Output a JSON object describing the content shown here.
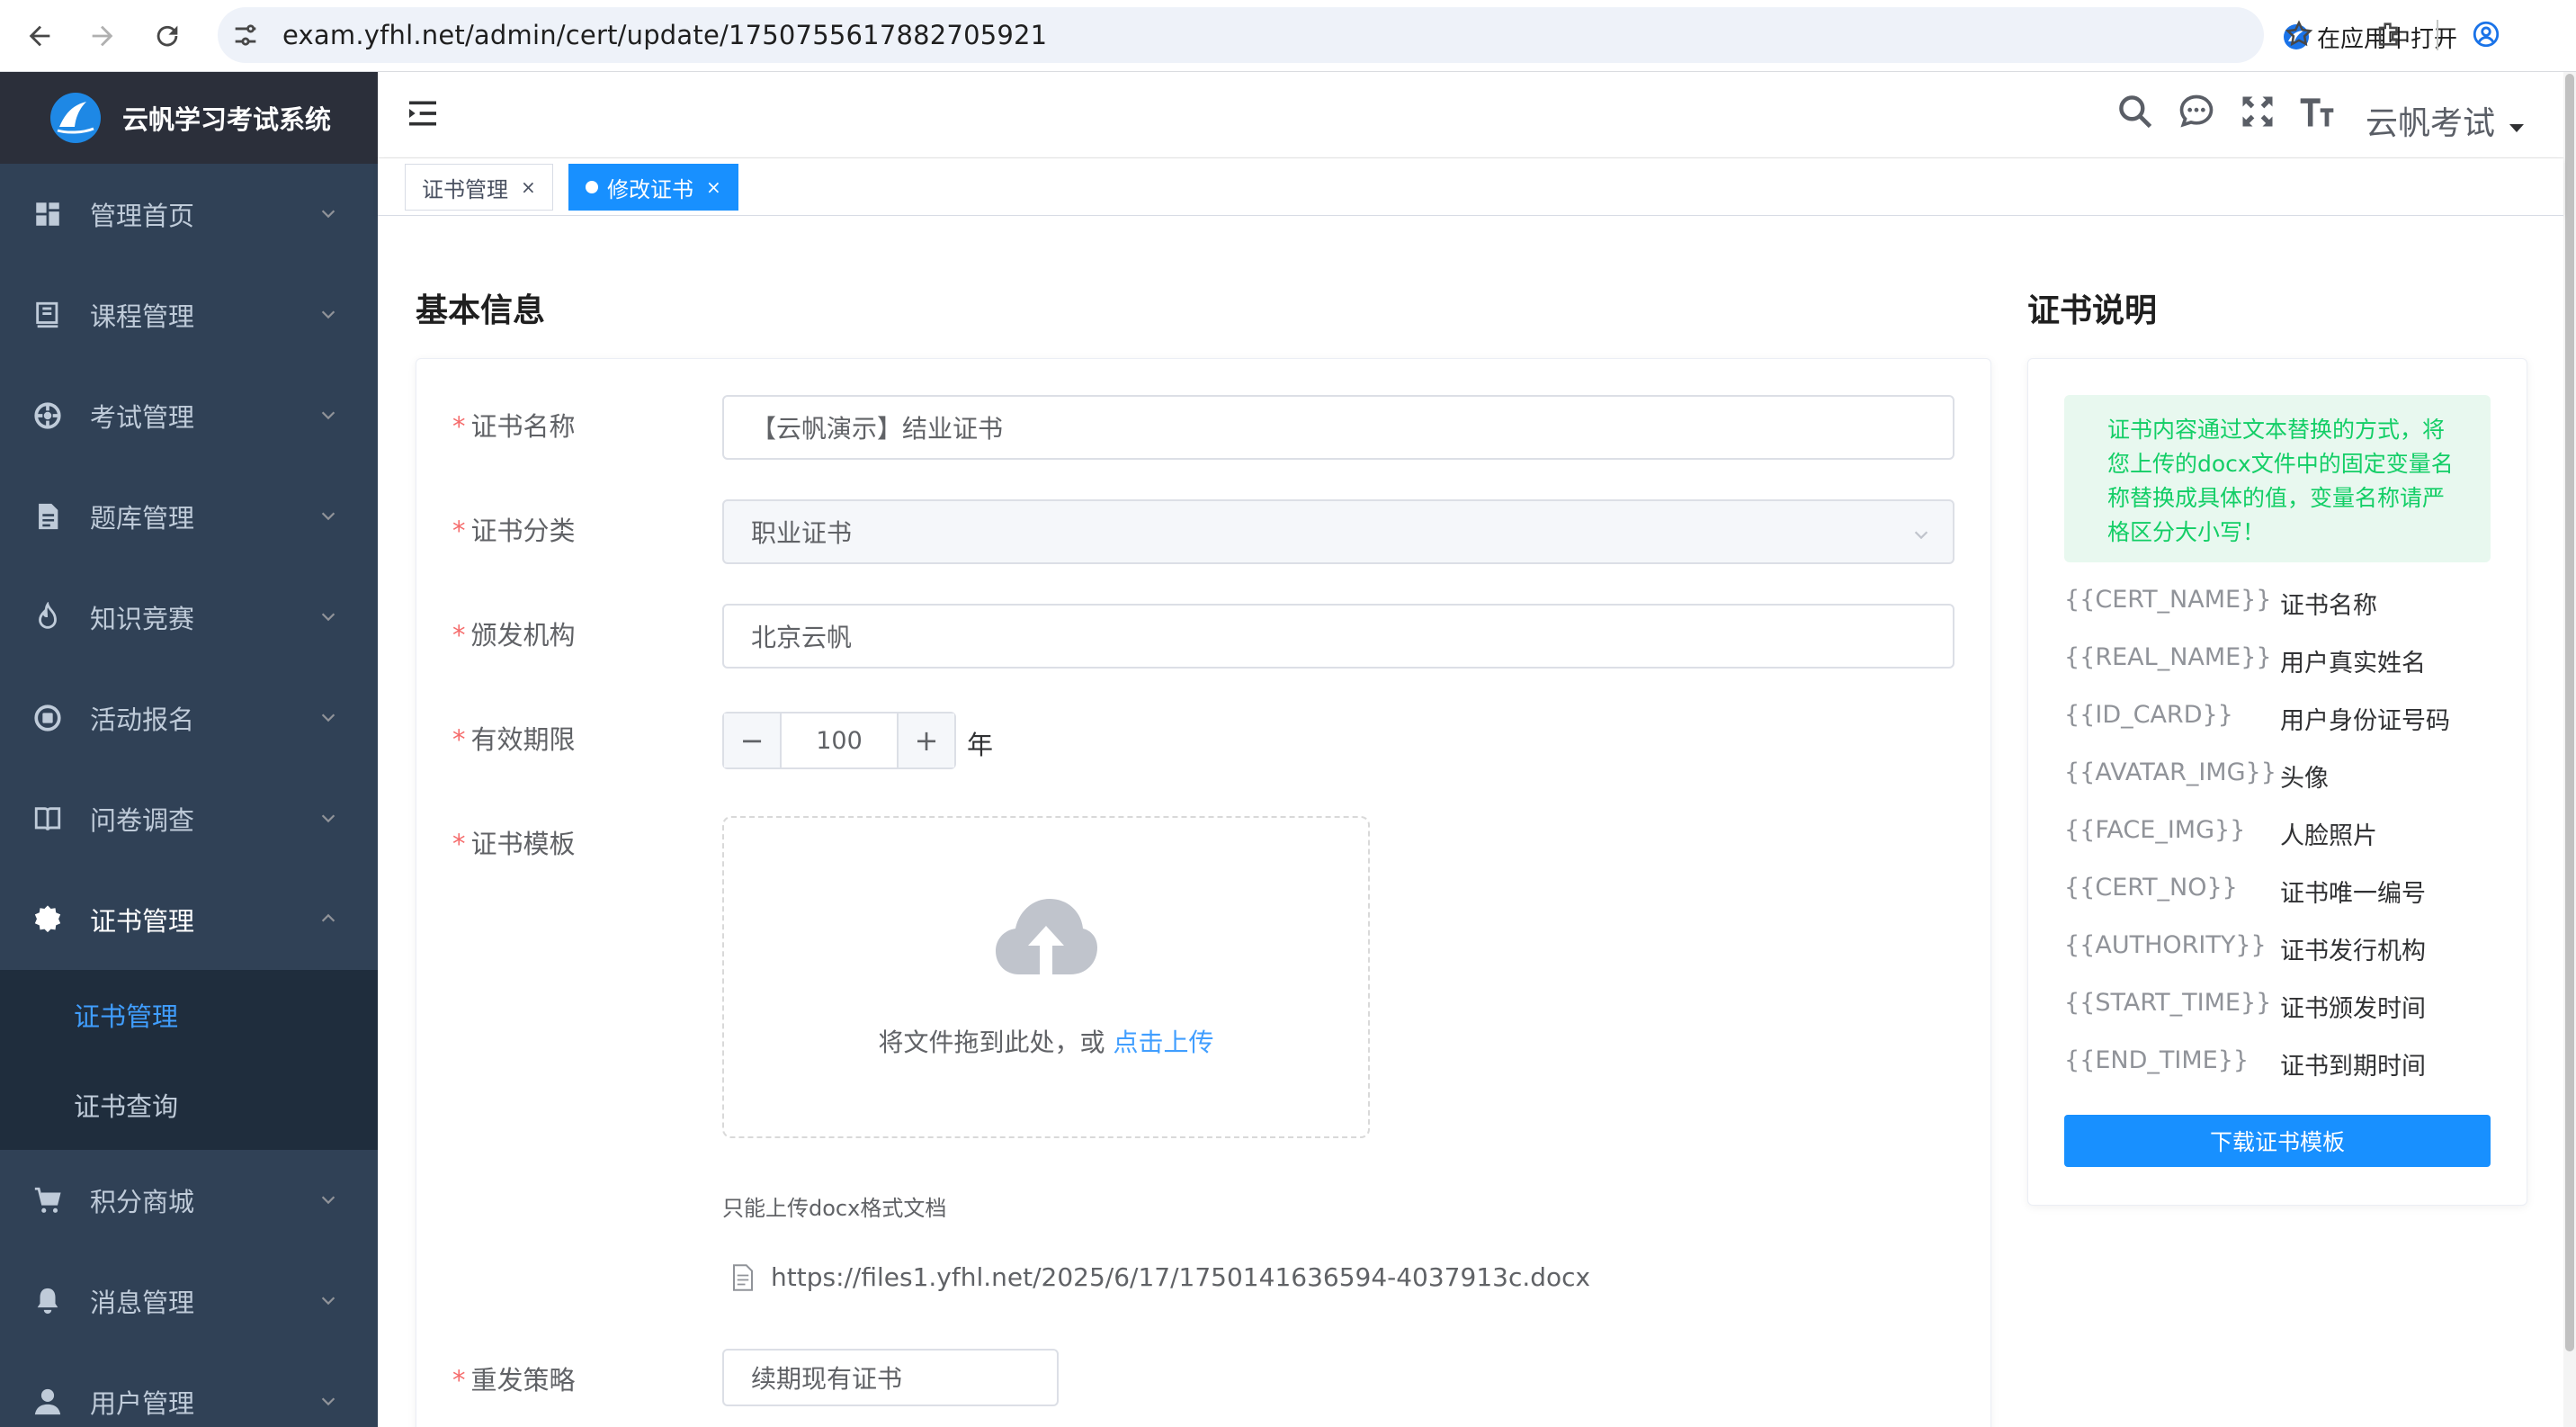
{
  "browser": {
    "url": "exam.yfhl.net/admin/cert/update/1750755617882705921",
    "open_in_app": "在应用中打开"
  },
  "app": {
    "brand_title": "云帆学习考试系统",
    "user_name": "云帆考试"
  },
  "sidebar": {
    "items": [
      {
        "label": "管理首页",
        "icon": "dashboard-icon"
      },
      {
        "label": "课程管理",
        "icon": "course-icon"
      },
      {
        "label": "考试管理",
        "icon": "exam-icon"
      },
      {
        "label": "题库管理",
        "icon": "question-bank-icon"
      },
      {
        "label": "知识竞赛",
        "icon": "fire-icon"
      },
      {
        "label": "活动报名",
        "icon": "activity-icon"
      },
      {
        "label": "问卷调查",
        "icon": "survey-icon"
      },
      {
        "label": "证书管理",
        "icon": "badge-icon"
      },
      {
        "label": "积分商城",
        "icon": "cart-icon"
      },
      {
        "label": "消息管理",
        "icon": "bell-icon"
      },
      {
        "label": "用户管理",
        "icon": "user-icon"
      }
    ],
    "submenu": [
      {
        "label": "证书管理"
      },
      {
        "label": "证书查询"
      }
    ]
  },
  "tags": [
    {
      "label": "证书管理"
    },
    {
      "label": "修改证书"
    }
  ],
  "form": {
    "section_title": "基本信息",
    "name": {
      "label": "证书名称",
      "value": "【云帆演示】结业证书"
    },
    "category": {
      "label": "证书分类",
      "value": "职业证书"
    },
    "authority": {
      "label": "颁发机构",
      "value": "北京云帆"
    },
    "validity": {
      "label": "有效期限",
      "value": "100",
      "unit": "年"
    },
    "template": {
      "label": "证书模板",
      "drag_text": "将文件拖到此处，或 ",
      "click_text": "点击上传",
      "tip": "只能上传docx格式文档",
      "file_url": "https://files1.yfhl.net/2025/6/17/1750141636594-4037913c.docx"
    },
    "reissue": {
      "label": "重发策略",
      "value": "续期现有证书"
    }
  },
  "cert_desc": {
    "title": "证书说明",
    "notice": "证书内容通过文本替换的方式，将您上传的docx文件中的固定变量名称替换成具体的值，变量名称请严格区分大小写！",
    "variables": [
      {
        "name": "{{CERT_NAME}}",
        "desc": "证书名称"
      },
      {
        "name": "{{REAL_NAME}}",
        "desc": "用户真实姓名"
      },
      {
        "name": "{{ID_CARD}}",
        "desc": "用户身份证号码"
      },
      {
        "name": "{{AVATAR_IMG}}",
        "desc": "头像"
      },
      {
        "name": "{{FACE_IMG}}",
        "desc": "人脸照片"
      },
      {
        "name": "{{CERT_NO}}",
        "desc": "证书唯一编号"
      },
      {
        "name": "{{AUTHORITY}}",
        "desc": "证书发行机构"
      },
      {
        "name": "{{START_TIME}}",
        "desc": "证书颁发时间"
      },
      {
        "name": "{{END_TIME}}",
        "desc": "证书到期时间"
      }
    ],
    "download_label": "下载证书模板"
  },
  "colors": {
    "sidebar_bg": "#304156",
    "primary": "#1890ff",
    "link": "#409eff",
    "required": "#f56c6c",
    "notice_text": "#13ce66"
  }
}
